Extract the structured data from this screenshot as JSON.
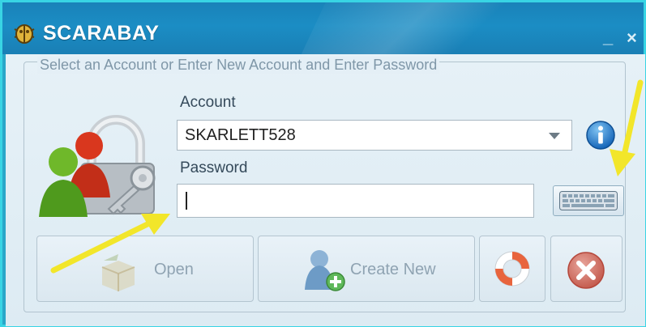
{
  "window": {
    "title": "SCARABAY",
    "minimize_label": "_",
    "close_label": "×"
  },
  "group": {
    "legend": "Select an Account or Enter New Account and Enter Password"
  },
  "form": {
    "account_label": "Account",
    "account_value": "SKARLETT528",
    "password_label": "Password",
    "password_value": ""
  },
  "buttons": {
    "open_label": "Open",
    "create_label": "Create New"
  },
  "icons": {
    "app": "scarab-icon",
    "users_lock": "users-lock-icon",
    "info": "info-icon",
    "keyboard": "keyboard-icon",
    "open": "open-box-icon",
    "create": "add-user-icon",
    "help": "lifebuoy-icon",
    "cancel": "cancel-icon"
  },
  "colors": {
    "titlebar": "#1a82b9",
    "client_bg": "#e4eff6",
    "annotation_arrow": "#f2e62a"
  }
}
